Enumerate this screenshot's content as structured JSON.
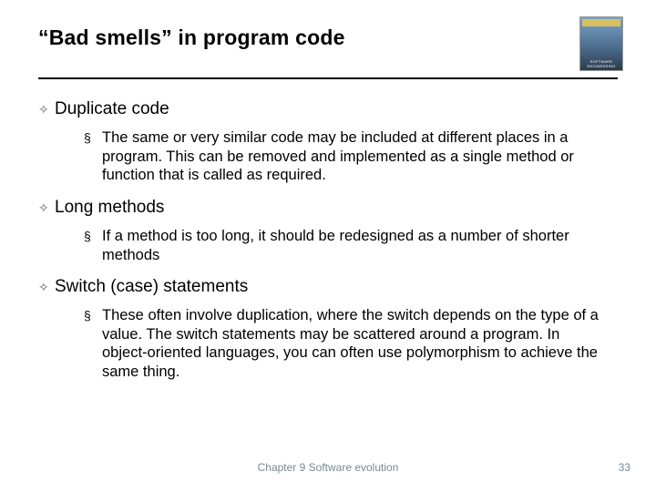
{
  "title": "“Bad smells” in program code",
  "book_cover_label": "SOFTWARE ENGINEERING",
  "sections": [
    {
      "heading": "Duplicate code",
      "body": "The same or very similar code may be included at different places in a program. This can be removed and implemented as a single method or function that is called as required.",
      "leading_space": ""
    },
    {
      "heading": "Long methods",
      "body": "If a method is too long, it should be redesigned as a number of shorter methods",
      "leading_space": " "
    },
    {
      "heading": "Switch (case) statements",
      "body": "These often involve duplication, where the switch depends on the type of a value. The switch statements may be scattered around a program. In object-oriented languages, you can often use polymorphism to achieve the same thing.",
      "leading_space": ""
    }
  ],
  "footer": {
    "center": "Chapter 9 Software evolution",
    "page": "33"
  }
}
